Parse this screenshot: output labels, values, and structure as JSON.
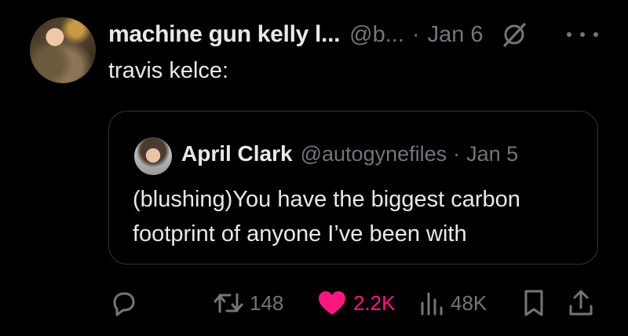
{
  "tweet": {
    "display_name": "machine gun kelly l...",
    "handle": "@b...",
    "separator": "·",
    "date": "Jan 6",
    "text": "travis kelce:"
  },
  "quoted_tweet": {
    "display_name": "April Clark",
    "handle": "@autogynefiles",
    "separator": "·",
    "date": "Jan 5",
    "text_line_1": "(blushing)You have the biggest carbon",
    "text_line_2": "footprint of anyone I’ve been with"
  },
  "actions": {
    "reply_count": "",
    "retweet_count": "148",
    "like_count": "2.2K",
    "views_count": "48K"
  },
  "colors": {
    "background": "#000000",
    "primary_text": "#e7e9ea",
    "secondary_text": "#71767b",
    "like_pink": "#f91880",
    "border": "#2f3336"
  },
  "icons": [
    "grok-icon",
    "more-icon",
    "reply-icon",
    "retweet-icon",
    "heart-icon",
    "views-icon",
    "bookmark-icon",
    "share-icon"
  ]
}
